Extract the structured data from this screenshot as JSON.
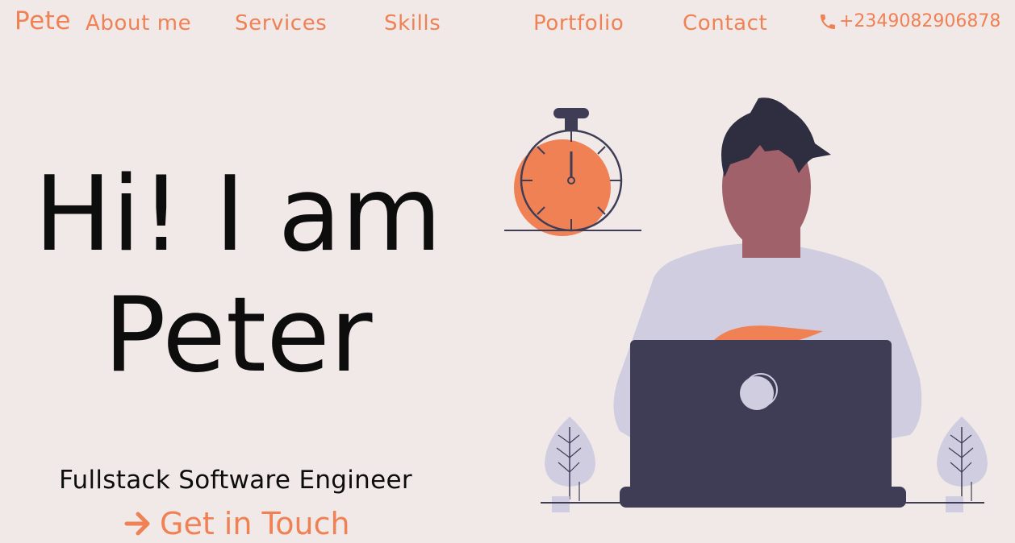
{
  "brand": "Pete",
  "nav": {
    "items": [
      {
        "label": "About me"
      },
      {
        "label": "Services"
      },
      {
        "label": "Skills"
      },
      {
        "label": "Portfolio"
      },
      {
        "label": "Contact"
      }
    ],
    "phone": "+2349082906878"
  },
  "hero": {
    "line1": "Hi! I am",
    "line2": "Peter",
    "role": "Fullstack Software Engineer",
    "cta": "Get in Touch"
  },
  "icons": {
    "phone": "phone-icon",
    "cta_arrow": "arrow-right-icon"
  },
  "colors": {
    "background": "#f1e9e7",
    "accent": "#f08154",
    "text": "#0d0d0d",
    "dark": "#3f3d56",
    "shirt": "#d0cde1",
    "skin": "#a0616a",
    "hair": "#2f2e41"
  }
}
